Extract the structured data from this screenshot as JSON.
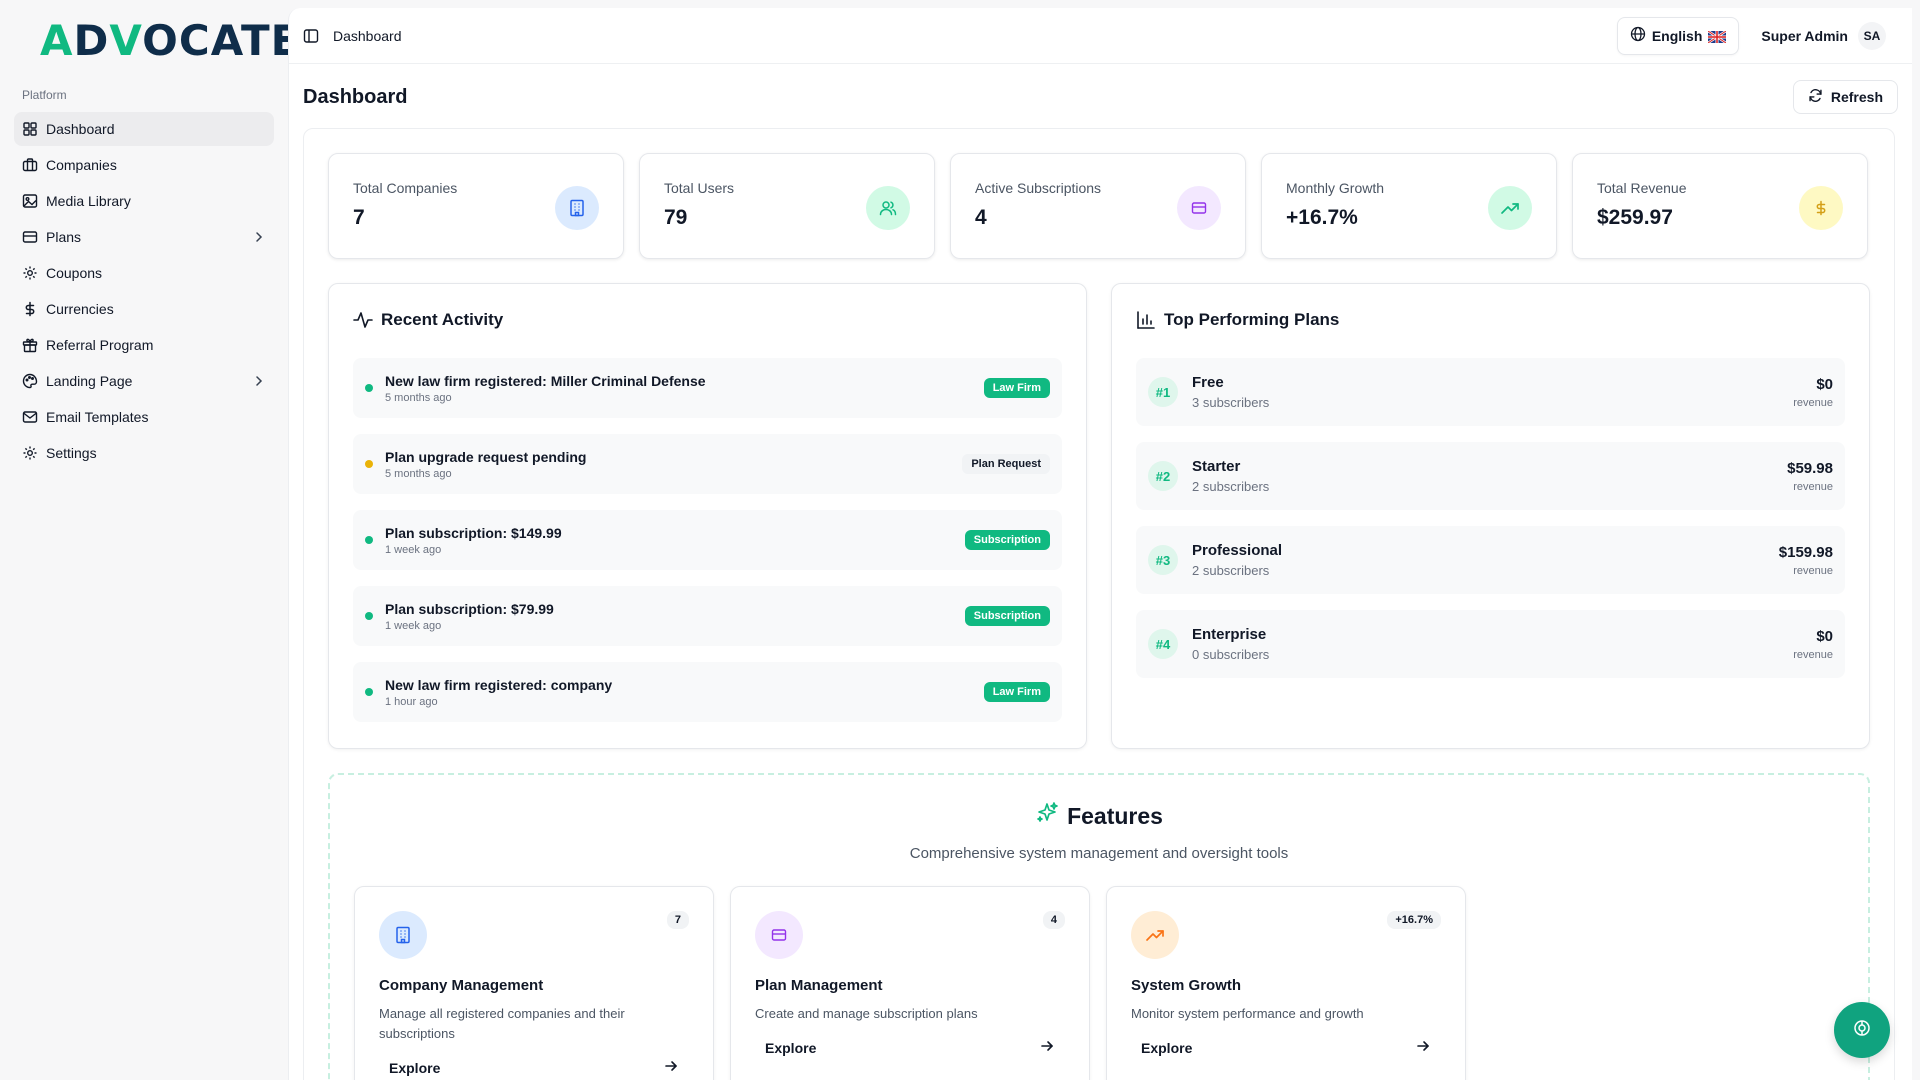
{
  "brand": {
    "logo_text": "ADVOCATE"
  },
  "sidebar": {
    "section_label": "Platform",
    "items": [
      {
        "label": "Dashboard",
        "icon": "layout-grid-icon",
        "active": true,
        "has_submenu": false
      },
      {
        "label": "Companies",
        "icon": "briefcase-icon",
        "active": false,
        "has_submenu": false
      },
      {
        "label": "Media Library",
        "icon": "image-icon",
        "active": false,
        "has_submenu": false
      },
      {
        "label": "Plans",
        "icon": "credit-card-icon",
        "active": false,
        "has_submenu": true
      },
      {
        "label": "Coupons",
        "icon": "gear-icon",
        "active": false,
        "has_submenu": false
      },
      {
        "label": "Currencies",
        "icon": "dollar-icon",
        "active": false,
        "has_submenu": false
      },
      {
        "label": "Referral Program",
        "icon": "gift-icon",
        "active": false,
        "has_submenu": false
      },
      {
        "label": "Landing Page",
        "icon": "palette-icon",
        "active": false,
        "has_submenu": true
      },
      {
        "label": "Email Templates",
        "icon": "mail-icon",
        "active": false,
        "has_submenu": false
      },
      {
        "label": "Settings",
        "icon": "gear-icon",
        "active": false,
        "has_submenu": false
      }
    ]
  },
  "topbar": {
    "breadcrumb": "Dashboard",
    "language": "English",
    "user_name": "Super Admin",
    "user_initials": "SA"
  },
  "page": {
    "title": "Dashboard",
    "refresh_label": "Refresh"
  },
  "stats": [
    {
      "label": "Total Companies",
      "value": "7",
      "icon": "building-icon",
      "color": "#2563eb",
      "bg": "#dbeafe"
    },
    {
      "label": "Total Users",
      "value": "79",
      "icon": "users-icon",
      "color": "#10b981",
      "bg": "#d1fae5"
    },
    {
      "label": "Active Subscriptions",
      "value": "4",
      "icon": "credit-card-icon",
      "color": "#9333ea",
      "bg": "#f3e8ff"
    },
    {
      "label": "Monthly Growth",
      "value": "+16.7%",
      "icon": "trending-up-icon",
      "color": "#10b981",
      "bg": "#d1fae5"
    },
    {
      "label": "Total Revenue",
      "value": "$259.97",
      "icon": "dollar-icon",
      "color": "#d4a017",
      "bg": "#fef9c3"
    }
  ],
  "recent_activity": {
    "title": "Recent Activity",
    "items": [
      {
        "title": "New law firm registered: Miller Criminal Defense",
        "time": "5 months ago",
        "badge": "Law Firm",
        "badge_style": "green",
        "dot_color": "#10b981"
      },
      {
        "title": "Plan upgrade request pending",
        "time": "5 months ago",
        "badge": "Plan Request",
        "badge_style": "gray",
        "dot_color": "#eab308"
      },
      {
        "title": "Plan subscription: $149.99",
        "time": "1 week ago",
        "badge": "Subscription",
        "badge_style": "green",
        "dot_color": "#10b981"
      },
      {
        "title": "Plan subscription: $79.99",
        "time": "1 week ago",
        "badge": "Subscription",
        "badge_style": "green",
        "dot_color": "#10b981"
      },
      {
        "title": "New law firm registered: company",
        "time": "1 hour ago",
        "badge": "Law Firm",
        "badge_style": "green",
        "dot_color": "#10b981"
      }
    ]
  },
  "top_plans": {
    "title": "Top Performing Plans",
    "revenue_label": "revenue",
    "items": [
      {
        "rank": "#1",
        "name": "Free",
        "subscribers": "3 subscribers",
        "revenue": "$0"
      },
      {
        "rank": "#2",
        "name": "Starter",
        "subscribers": "2 subscribers",
        "revenue": "$59.98"
      },
      {
        "rank": "#3",
        "name": "Professional",
        "subscribers": "2 subscribers",
        "revenue": "$159.98"
      },
      {
        "rank": "#4",
        "name": "Enterprise",
        "subscribers": "0 subscribers",
        "revenue": "$0"
      }
    ]
  },
  "features": {
    "title": "Features",
    "subtitle": "Comprehensive system management and oversight tools",
    "cards": [
      {
        "title": "Company Management",
        "description": "Manage all registered companies and their subscriptions",
        "count": "7",
        "explore": "Explore",
        "icon": "building-icon",
        "color": "#2563eb",
        "bg": "#dbeafe"
      },
      {
        "title": "Plan Management",
        "description": "Create and manage subscription plans",
        "count": "4",
        "explore": "Explore",
        "icon": "credit-card-icon",
        "color": "#9333ea",
        "bg": "#f3e8ff"
      },
      {
        "title": "System Growth",
        "description": "Monitor system performance and growth",
        "count": "+16.7%",
        "explore": "Explore",
        "icon": "trending-up-icon",
        "color": "#f97316",
        "bg": "#ffedd5"
      }
    ]
  },
  "colors": {
    "accent": "#10b981",
    "brand_dark": "#0f2d4a"
  }
}
